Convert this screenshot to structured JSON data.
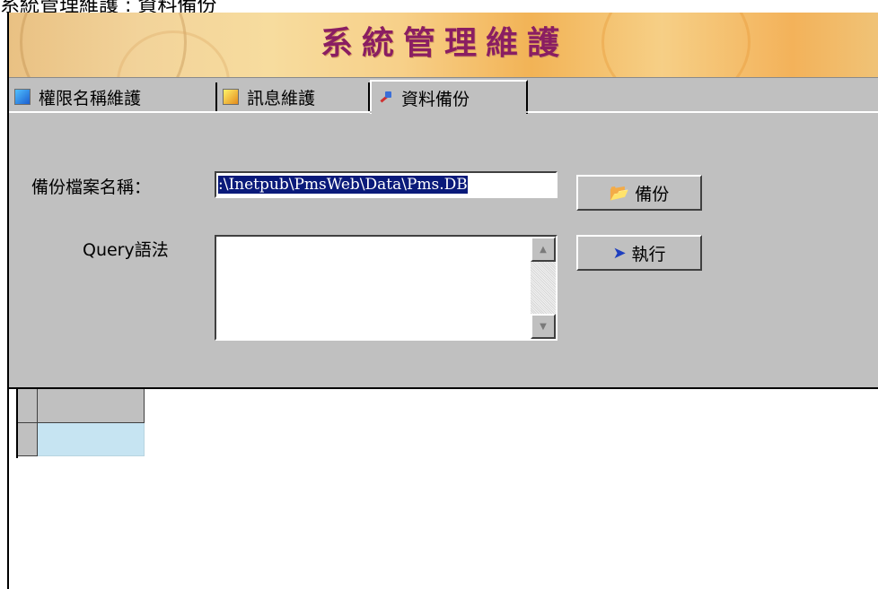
{
  "window": {
    "title": "系統管理維護"
  },
  "top_strip_text": "系統管理維護 : 資料備份",
  "tabs": [
    {
      "label": "權限名稱維護",
      "icon": "permission-icon",
      "active": false
    },
    {
      "label": "訊息維護",
      "icon": "message-icon",
      "active": false
    },
    {
      "label": "資料備份",
      "icon": "backup-icon",
      "active": true
    }
  ],
  "backup": {
    "label": "備份檔案名稱：",
    "value": ":\\Inetpub\\PmsWeb\\Data\\Pms.DB",
    "button_label": "備份"
  },
  "query": {
    "label": "Query語法",
    "value": "",
    "button_label": "執行"
  },
  "colors": {
    "title": "#8a1e62",
    "selection": "#0a1a7a",
    "grid_cell": "#c6e4f2",
    "panel": "#c0c0c0"
  }
}
